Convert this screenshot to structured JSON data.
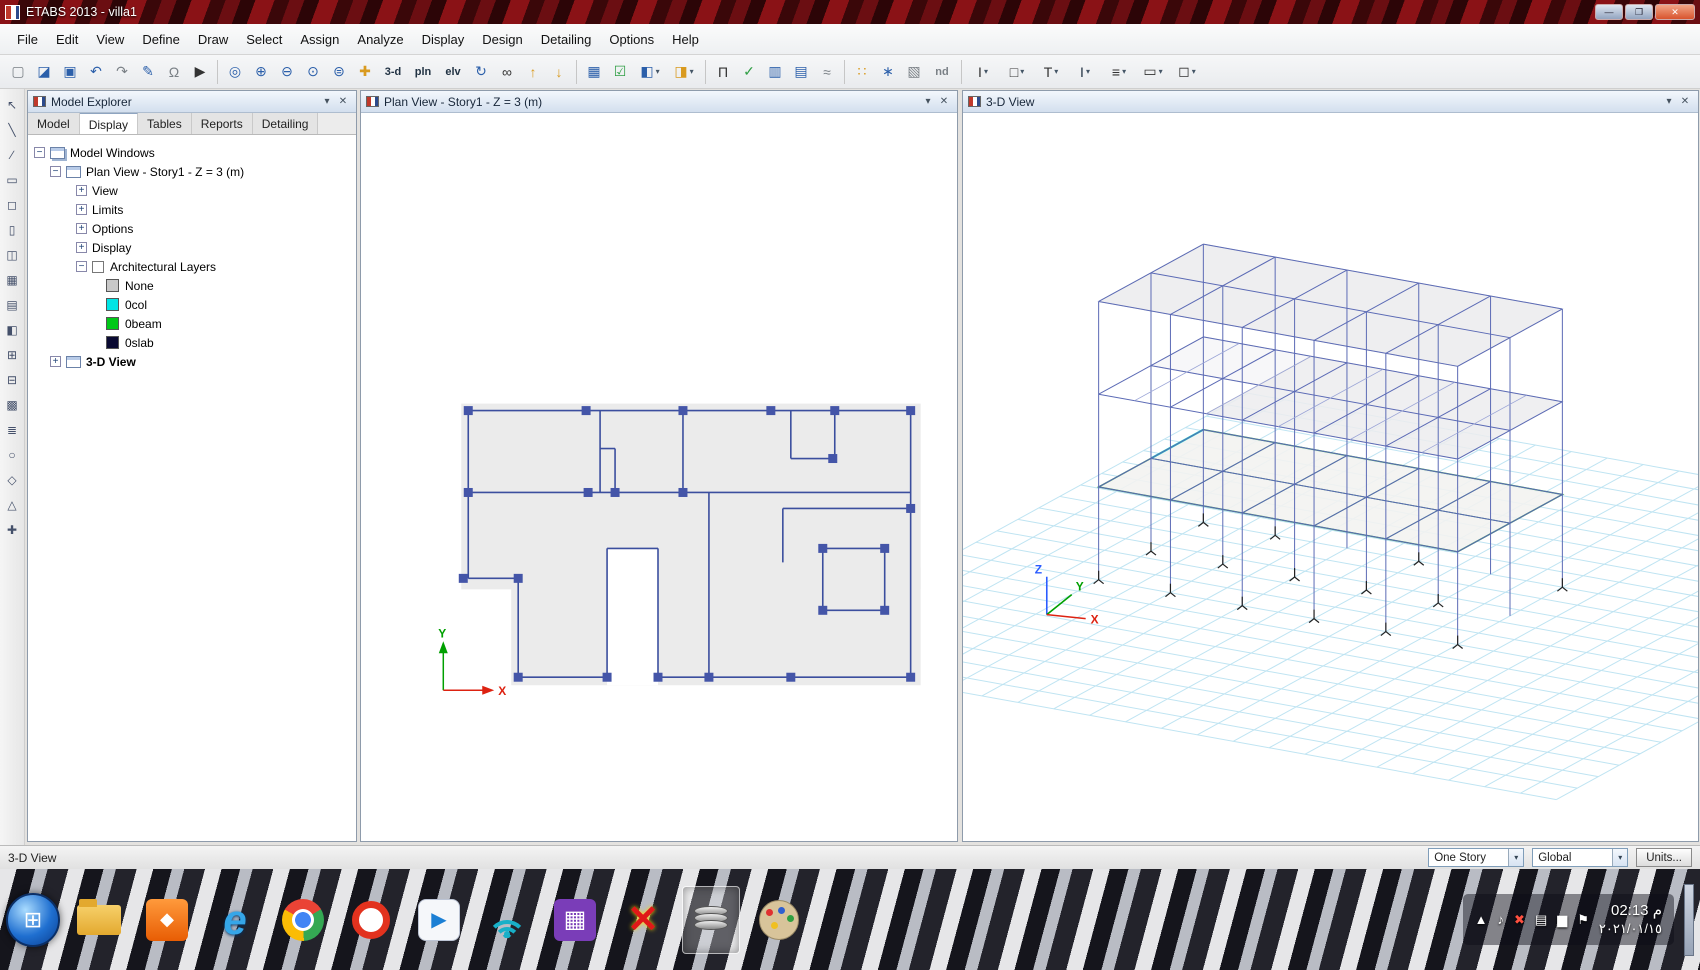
{
  "window": {
    "title": "ETABS 2013 - villa1",
    "minimize_glyph": "―",
    "restore_glyph": "❐",
    "close_glyph": "✕"
  },
  "menu": {
    "items": [
      "File",
      "Edit",
      "View",
      "Define",
      "Draw",
      "Select",
      "Assign",
      "Analyze",
      "Display",
      "Design",
      "Detailing",
      "Options",
      "Help"
    ]
  },
  "toolbar": {
    "text_buttons": {
      "view3d": "3-d",
      "plan": "pln",
      "elev": "elv",
      "nd": "nd"
    },
    "glyphs": {
      "new": "▢",
      "tags": "◪",
      "save": "▣",
      "undo": "↶",
      "redo": "↷",
      "pen": "✎",
      "lock": "Ω",
      "run": "▶",
      "zoom_window": "◎",
      "zoom_in": "⊕",
      "zoom_out": "⊖",
      "zoom_full": "⊙",
      "zoom_prev": "⊜",
      "pan": "✚",
      "rotate": "↻",
      "perspective": "∞",
      "up": "↑",
      "down": "↓",
      "shrink": "▦",
      "check": "☑",
      "cube1": "◧",
      "cube2": "◨",
      "frame": "Π",
      "brace": "✓",
      "floor": "▥",
      "wall": "▤",
      "link": "≈",
      "snap1": "∷",
      "snap2": "∗",
      "snap3": "▧",
      "joint": "I",
      "frame2": "□",
      "tee": "T",
      "col": "I",
      "beam": "≡",
      "slab": "▭",
      "wall2": "◻",
      "caret": "▾"
    },
    "left_glyphs": [
      "↖",
      "╲",
      "∕",
      "▭",
      "◻",
      "▯",
      "◫",
      "▦",
      "▤",
      "◧",
      "⊞",
      "⊟",
      "▩",
      "≣",
      "○",
      "◇",
      "△",
      "✚"
    ]
  },
  "model_explorer": {
    "title": "Model Explorer",
    "tabs": [
      "Model",
      "Display",
      "Tables",
      "Reports",
      "Detailing"
    ],
    "glyph_collapse": "−",
    "glyph_expand": "+",
    "tree": {
      "root": "Model Windows",
      "plan_node": "Plan View - Story1 - Z = 3 (m)",
      "plan_children": [
        "View",
        "Limits",
        "Options",
        "Display"
      ],
      "arch_layers": "Architectural Layers",
      "layers": [
        {
          "label": "None",
          "color": "#c8c8c8"
        },
        {
          "label": "0col",
          "color": "#00e5e5"
        },
        {
          "label": "0beam",
          "color": "#00c818"
        },
        {
          "label": "0slab",
          "color": "#0a0a32"
        }
      ],
      "view3d_node": "3-D View"
    }
  },
  "panels": {
    "plan_title": "Plan View - Story1 - Z = 3 (m)",
    "view3d_title": "3-D View"
  },
  "axes": {
    "plan": {
      "x": "X",
      "y": "Y"
    },
    "view3d": {
      "x": "X",
      "y": "Y",
      "z": "Z"
    }
  },
  "statusbar": {
    "left_text": "3-D View",
    "story": "One Story",
    "coords": "Global",
    "units": "Units...",
    "caret": "▾"
  },
  "taskbar": {
    "time": "02:13 م",
    "date": "٢٠٢١/٠١/١٥",
    "start_glyph": "⊞",
    "ie_glyph": "e",
    "orange_glyph": "◆",
    "play_glyph": "▶",
    "grid_glyph": "▦",
    "x_glyph": "✕",
    "tray": {
      "expand": "▲",
      "volume": "♪",
      "network": "▆",
      "flag": "⚑",
      "keyboard": "▤",
      "alert": "✖"
    }
  },
  "colors": {
    "titlebar": "#7c1116",
    "grid3d": "#bfe4f2",
    "frame": "#5b6ab5",
    "frame_light": "#9aa4d6",
    "deck_green": "#23913f",
    "teal": "#19c2c2",
    "slab": "#ededef",
    "slab_edge": "#cfd0d6",
    "support": "#222222",
    "axis_x": "#dd2211",
    "axis_y": "#00a000",
    "axis_z": "#2b5cff",
    "plan_wall": "#3b4e9e",
    "plan_column": "#4455a8"
  }
}
